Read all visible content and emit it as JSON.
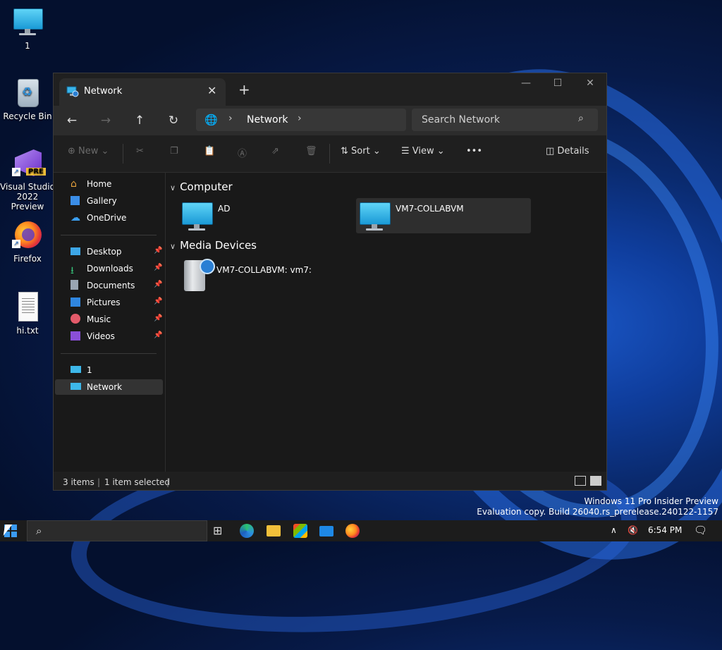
{
  "desktop": {
    "icons": [
      {
        "label": "1"
      },
      {
        "label": "Recycle Bin"
      },
      {
        "label": "Visual Studio 2022 Preview",
        "badge": "PRE"
      },
      {
        "label": "Firefox"
      },
      {
        "label": "hi.txt"
      }
    ]
  },
  "explorer": {
    "tab_title": "Network",
    "address_crumb": "Network",
    "search_placeholder": "Search Network",
    "commands": {
      "new": "New",
      "sort": "Sort",
      "view": "View",
      "more": "•••",
      "details": "Details"
    },
    "nav": {
      "quick": [
        {
          "label": "Home",
          "icon": "home-icon"
        },
        {
          "label": "Gallery",
          "icon": "gallery-icon"
        },
        {
          "label": "OneDrive",
          "icon": "onedrive-icon"
        }
      ],
      "pinned": [
        {
          "label": "Desktop",
          "icon": "desktop-folder-icon"
        },
        {
          "label": "Downloads",
          "icon": "download-icon"
        },
        {
          "label": "Documents",
          "icon": "documents-icon"
        },
        {
          "label": "Pictures",
          "icon": "pictures-icon"
        },
        {
          "label": "Music",
          "icon": "music-icon"
        },
        {
          "label": "Videos",
          "icon": "videos-icon"
        }
      ],
      "locations": [
        {
          "label": "1",
          "icon": "computer-icon"
        },
        {
          "label": "Network",
          "icon": "network-icon",
          "selected": true
        }
      ]
    },
    "groups": [
      {
        "name": "Computer",
        "items": [
          {
            "label": "AD",
            "selected": false
          },
          {
            "label": "VM7-COLLABVM",
            "selected": true
          }
        ]
      },
      {
        "name": "Media Devices",
        "items": [
          {
            "label": "VM7-COLLABVM: vm7:",
            "selected": false
          }
        ]
      }
    ],
    "status": {
      "items": "3 items",
      "selected": "1 item selected"
    }
  },
  "watermark": {
    "line1": "Windows 11 Pro Insider Preview",
    "line2": "Evaluation copy. Build 26040.rs_prerelease.240122-1157"
  },
  "taskbar": {
    "clock": "6:54 PM"
  },
  "colors": {
    "accent": "#3a9cf4",
    "window_bg": "#191919",
    "selection": "#333333"
  }
}
